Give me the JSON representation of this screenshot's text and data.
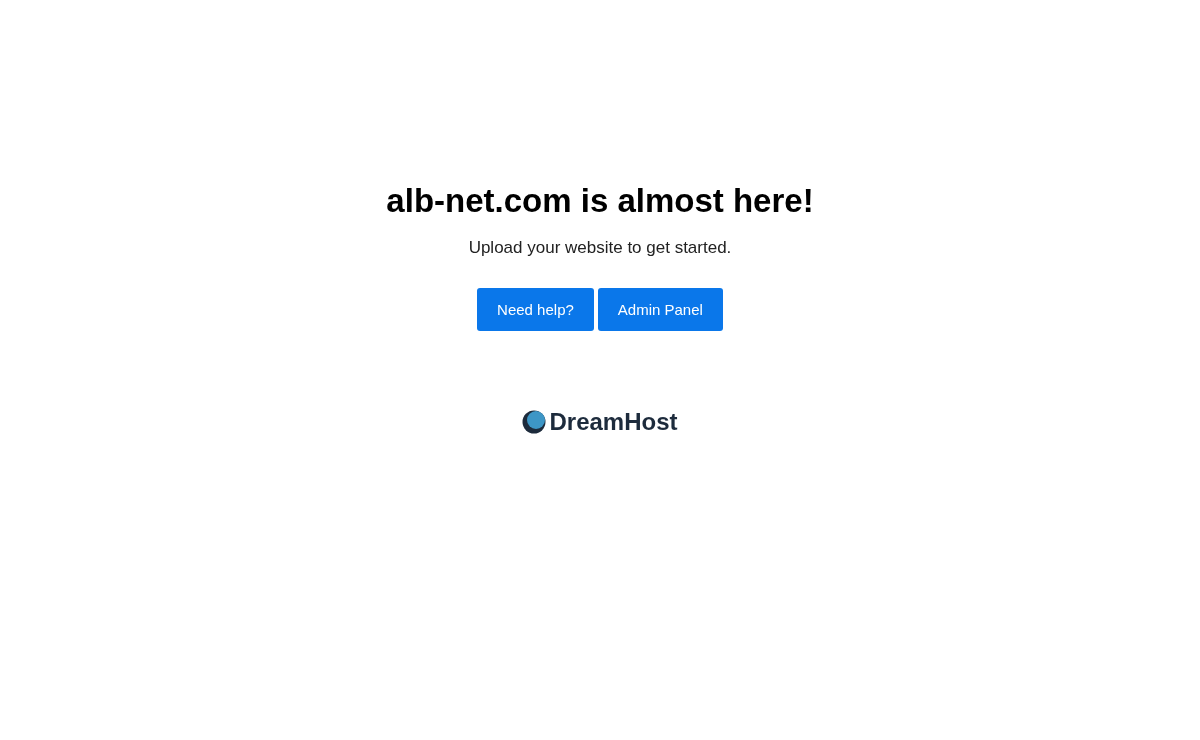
{
  "heading": "alb-net.com is almost here!",
  "subtitle": "Upload your website to get started.",
  "buttons": [
    {
      "label": "Need help?"
    },
    {
      "label": "Admin Panel"
    }
  ],
  "logo": {
    "text": "DreamHost"
  }
}
